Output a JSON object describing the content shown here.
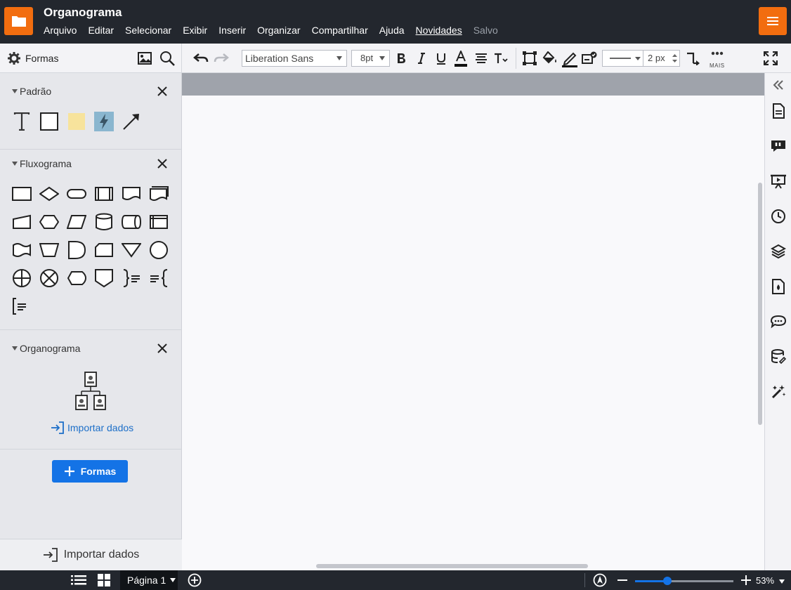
{
  "header": {
    "title": "Organograma",
    "menu": [
      "Arquivo",
      "Editar",
      "Selecionar",
      "Exibir",
      "Inserir",
      "Organizar",
      "Compartilhar",
      "Ajuda",
      "Novidades"
    ],
    "saved_status": "Salvo",
    "accent_color": "#f26d0f"
  },
  "toolbar": {
    "shapes_label": "Formas",
    "font_family": "Liberation Sans",
    "font_size": "8pt",
    "line_width": "2 px",
    "more_label": "MAIS"
  },
  "left_panel": {
    "sections": [
      {
        "name": "Padrão"
      },
      {
        "name": "Fluxograma"
      },
      {
        "name": "Organograma"
      }
    ],
    "import_link": "Importar dados",
    "add_shapes_button": "Formas",
    "import_bottom": "Importar dados"
  },
  "bottom": {
    "page_tab": "Página 1",
    "zoom": "53%",
    "zoom_fraction": 0.33
  }
}
